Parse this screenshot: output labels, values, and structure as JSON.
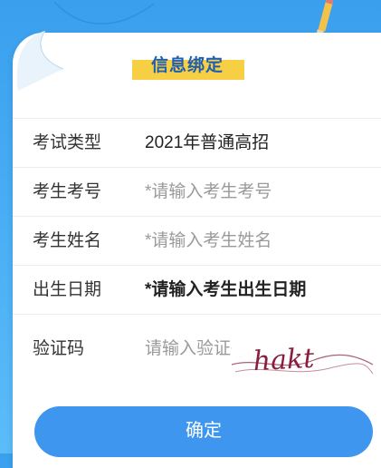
{
  "form": {
    "title": "信息绑定",
    "fields": [
      {
        "label": "考试类型",
        "value": "2021年普通高招"
      },
      {
        "label": "考生考号",
        "placeholder": "*请输入考生考号"
      },
      {
        "label": "考生姓名",
        "placeholder": "*请输入考生姓名"
      },
      {
        "label": "出生日期",
        "placeholder": "*请输入考生出生日期"
      },
      {
        "label": "验证码",
        "placeholder": "请输入验证码"
      }
    ],
    "captcha_text": "hakt",
    "submit_label": "确定"
  },
  "colors": {
    "background": "#4aaef4",
    "button": "#3f96ee",
    "title_highlight": "#f6cf45",
    "title_text": "#1f5fb3",
    "captcha_ink": "#8a1d3d"
  }
}
